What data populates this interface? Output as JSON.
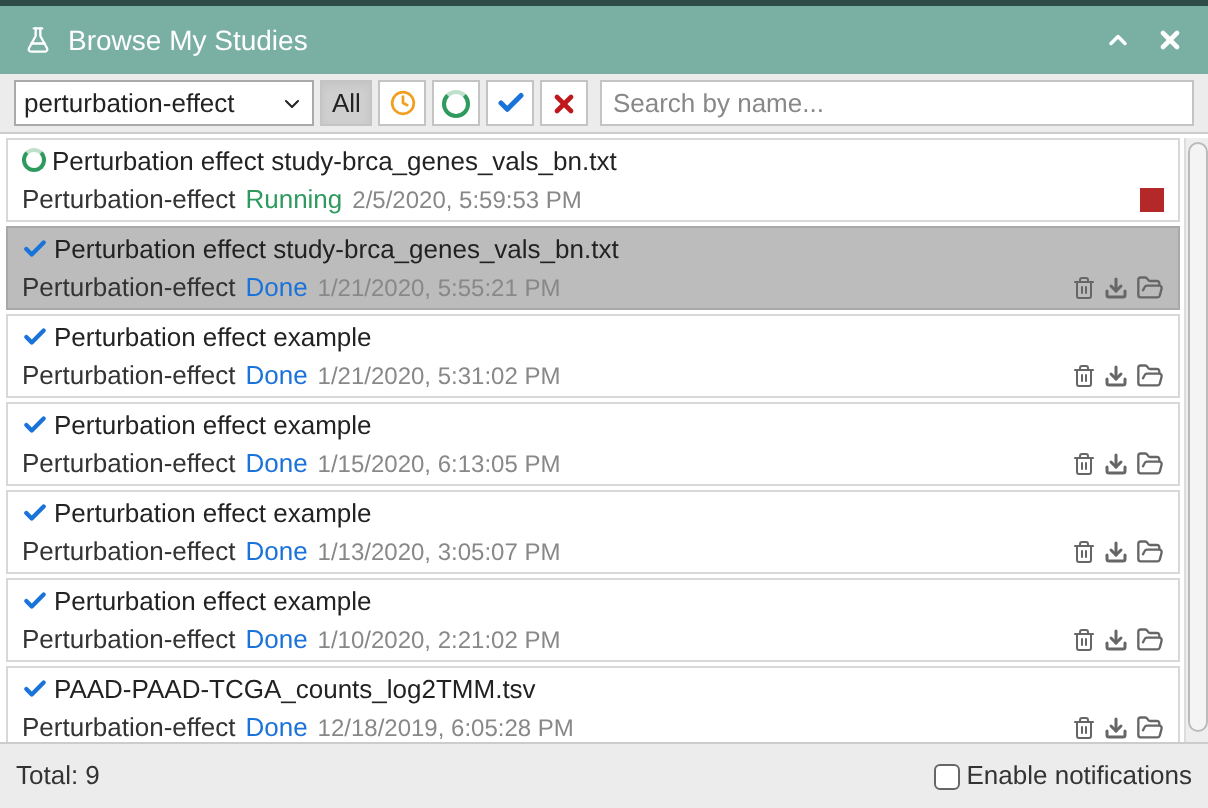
{
  "window": {
    "title": "Browse My Studies"
  },
  "toolbar": {
    "type_select": "perturbation-effect",
    "filters": [
      {
        "kind": "all",
        "label": "All",
        "selected": true
      },
      {
        "kind": "queued",
        "selected": false
      },
      {
        "kind": "running",
        "selected": false
      },
      {
        "kind": "done",
        "selected": false
      },
      {
        "kind": "failed",
        "selected": false
      }
    ],
    "search": {
      "placeholder": "Search by name..."
    }
  },
  "studies": [
    {
      "name": "Perturbation effect study-brca_genes_vals_bn.txt",
      "type": "Perturbation-effect",
      "status": "Running",
      "kind": "running",
      "date": "2/5/2020, 5:59:53 PM",
      "selected": false
    },
    {
      "name": "Perturbation effect study-brca_genes_vals_bn.txt",
      "type": "Perturbation-effect",
      "status": "Done",
      "kind": "done",
      "date": "1/21/2020, 5:55:21 PM",
      "selected": true
    },
    {
      "name": "Perturbation effect example",
      "type": "Perturbation-effect",
      "status": "Done",
      "kind": "done",
      "date": "1/21/2020, 5:31:02 PM",
      "selected": false
    },
    {
      "name": "Perturbation effect example",
      "type": "Perturbation-effect",
      "status": "Done",
      "kind": "done",
      "date": "1/15/2020, 6:13:05 PM",
      "selected": false
    },
    {
      "name": "Perturbation effect example",
      "type": "Perturbation-effect",
      "status": "Done",
      "kind": "done",
      "date": "1/13/2020, 3:05:07 PM",
      "selected": false
    },
    {
      "name": "Perturbation effect example",
      "type": "Perturbation-effect",
      "status": "Done",
      "kind": "done",
      "date": "1/10/2020, 2:21:02 PM",
      "selected": false
    },
    {
      "name": "PAAD-PAAD-TCGA_counts_log2TMM.tsv",
      "type": "Perturbation-effect",
      "status": "Done",
      "kind": "done",
      "date": "12/18/2019, 6:05:28 PM",
      "selected": false
    }
  ],
  "status_bar": {
    "total": "Total: 9",
    "notifications": {
      "label": "Enable notifications",
      "checked": false
    }
  }
}
